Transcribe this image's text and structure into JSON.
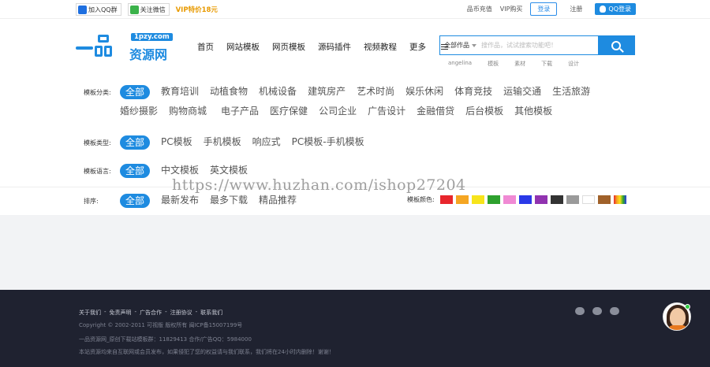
{
  "topbar": {
    "qq_group": "加入QQ群",
    "wechat_follow": "关注微信",
    "vip_promo": "VIP特价18元",
    "recharge": "品币充值",
    "vip_buy": "VIP购买",
    "login": "登录",
    "register": "注册",
    "qq_login": "QQ登录"
  },
  "logo": {
    "domain": "1pzy.com",
    "cn": "资源网"
  },
  "nav": [
    "首页",
    "网站模板",
    "网页模板",
    "源码插件",
    "视频教程",
    "更多"
  ],
  "search": {
    "category": "全部作品",
    "placeholder": "搜作品，试试搜索功能吧！",
    "hotwords": [
      "angelina",
      "模板",
      "素材",
      "下载",
      "设计"
    ]
  },
  "filters": {
    "category": {
      "label": "模板分类:",
      "options": [
        "全部",
        "教育培训",
        "动植食物",
        "机械设备",
        "建筑房产",
        "艺术时尚",
        "娱乐休闲",
        "体育竞技",
        "运输交通",
        "生活旅游",
        "婚纱摄影",
        "购物商城",
        "电子产品",
        "医疗保健",
        "公司企业",
        "广告设计",
        "金融借贷",
        "后台模板",
        "其他模板"
      ]
    },
    "type": {
      "label": "模板类型:",
      "options": [
        "全部",
        "PC模板",
        "手机模板",
        "响应式",
        "PC模板-手机模板"
      ]
    },
    "language": {
      "label": "模板语言:",
      "options": [
        "全部",
        "中文模板",
        "英文模板"
      ]
    },
    "sort": {
      "label": "排序:",
      "options": [
        "全部",
        "最新发布",
        "最多下载",
        "精品推荐"
      ]
    },
    "colors_label": "模板颜色:",
    "colors": [
      "#e8262c",
      "#f5a623",
      "#f7e41b",
      "#2ea12e",
      "#f08ad4",
      "#2a39e8",
      "#9133b0",
      "#333333",
      "#9a9a9a",
      "#ffffff",
      "#a0612a",
      "rainbow"
    ]
  },
  "watermark": "https://www.huzhan.com/ishop27204",
  "footer": {
    "links": [
      "关于我们",
      "-",
      "免责声明",
      "-",
      "广告合作",
      "-",
      "注册协议",
      "-",
      "联系我们"
    ],
    "copyright": "Copyright © 2002-2011 可视版 版权所有 闽ICP备15007199号",
    "stats": "一品资源网_原创下载站模板群：11829413 合作/广告QQ：5984000",
    "notice": "本站资源均来自互联网或会员发布，如果侵犯了您的权益请与我们联系，我们将在24小时内删除！谢谢！"
  }
}
